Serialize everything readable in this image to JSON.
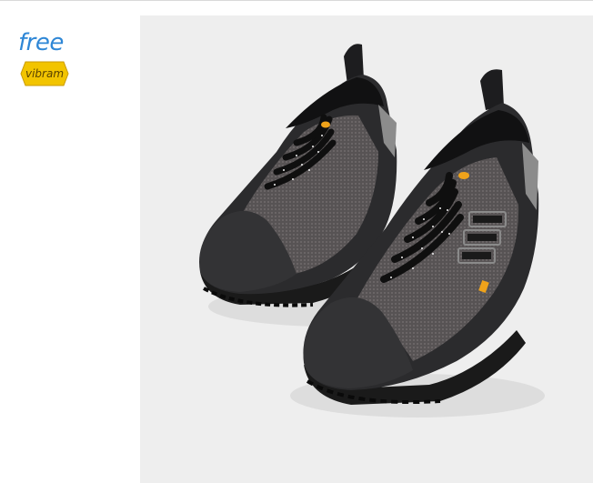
{
  "brand": {
    "tagline": "free",
    "sole_logo_text": "vibram",
    "sole_logo_color": "#f2c400",
    "tagline_color": "#2f87d6"
  },
  "product": {
    "image_icon": "barefoot-shoe-pair",
    "background_color": "#eeeeee",
    "shoe_color": "#2b2b2d",
    "accent_color": "#f0a31a"
  }
}
